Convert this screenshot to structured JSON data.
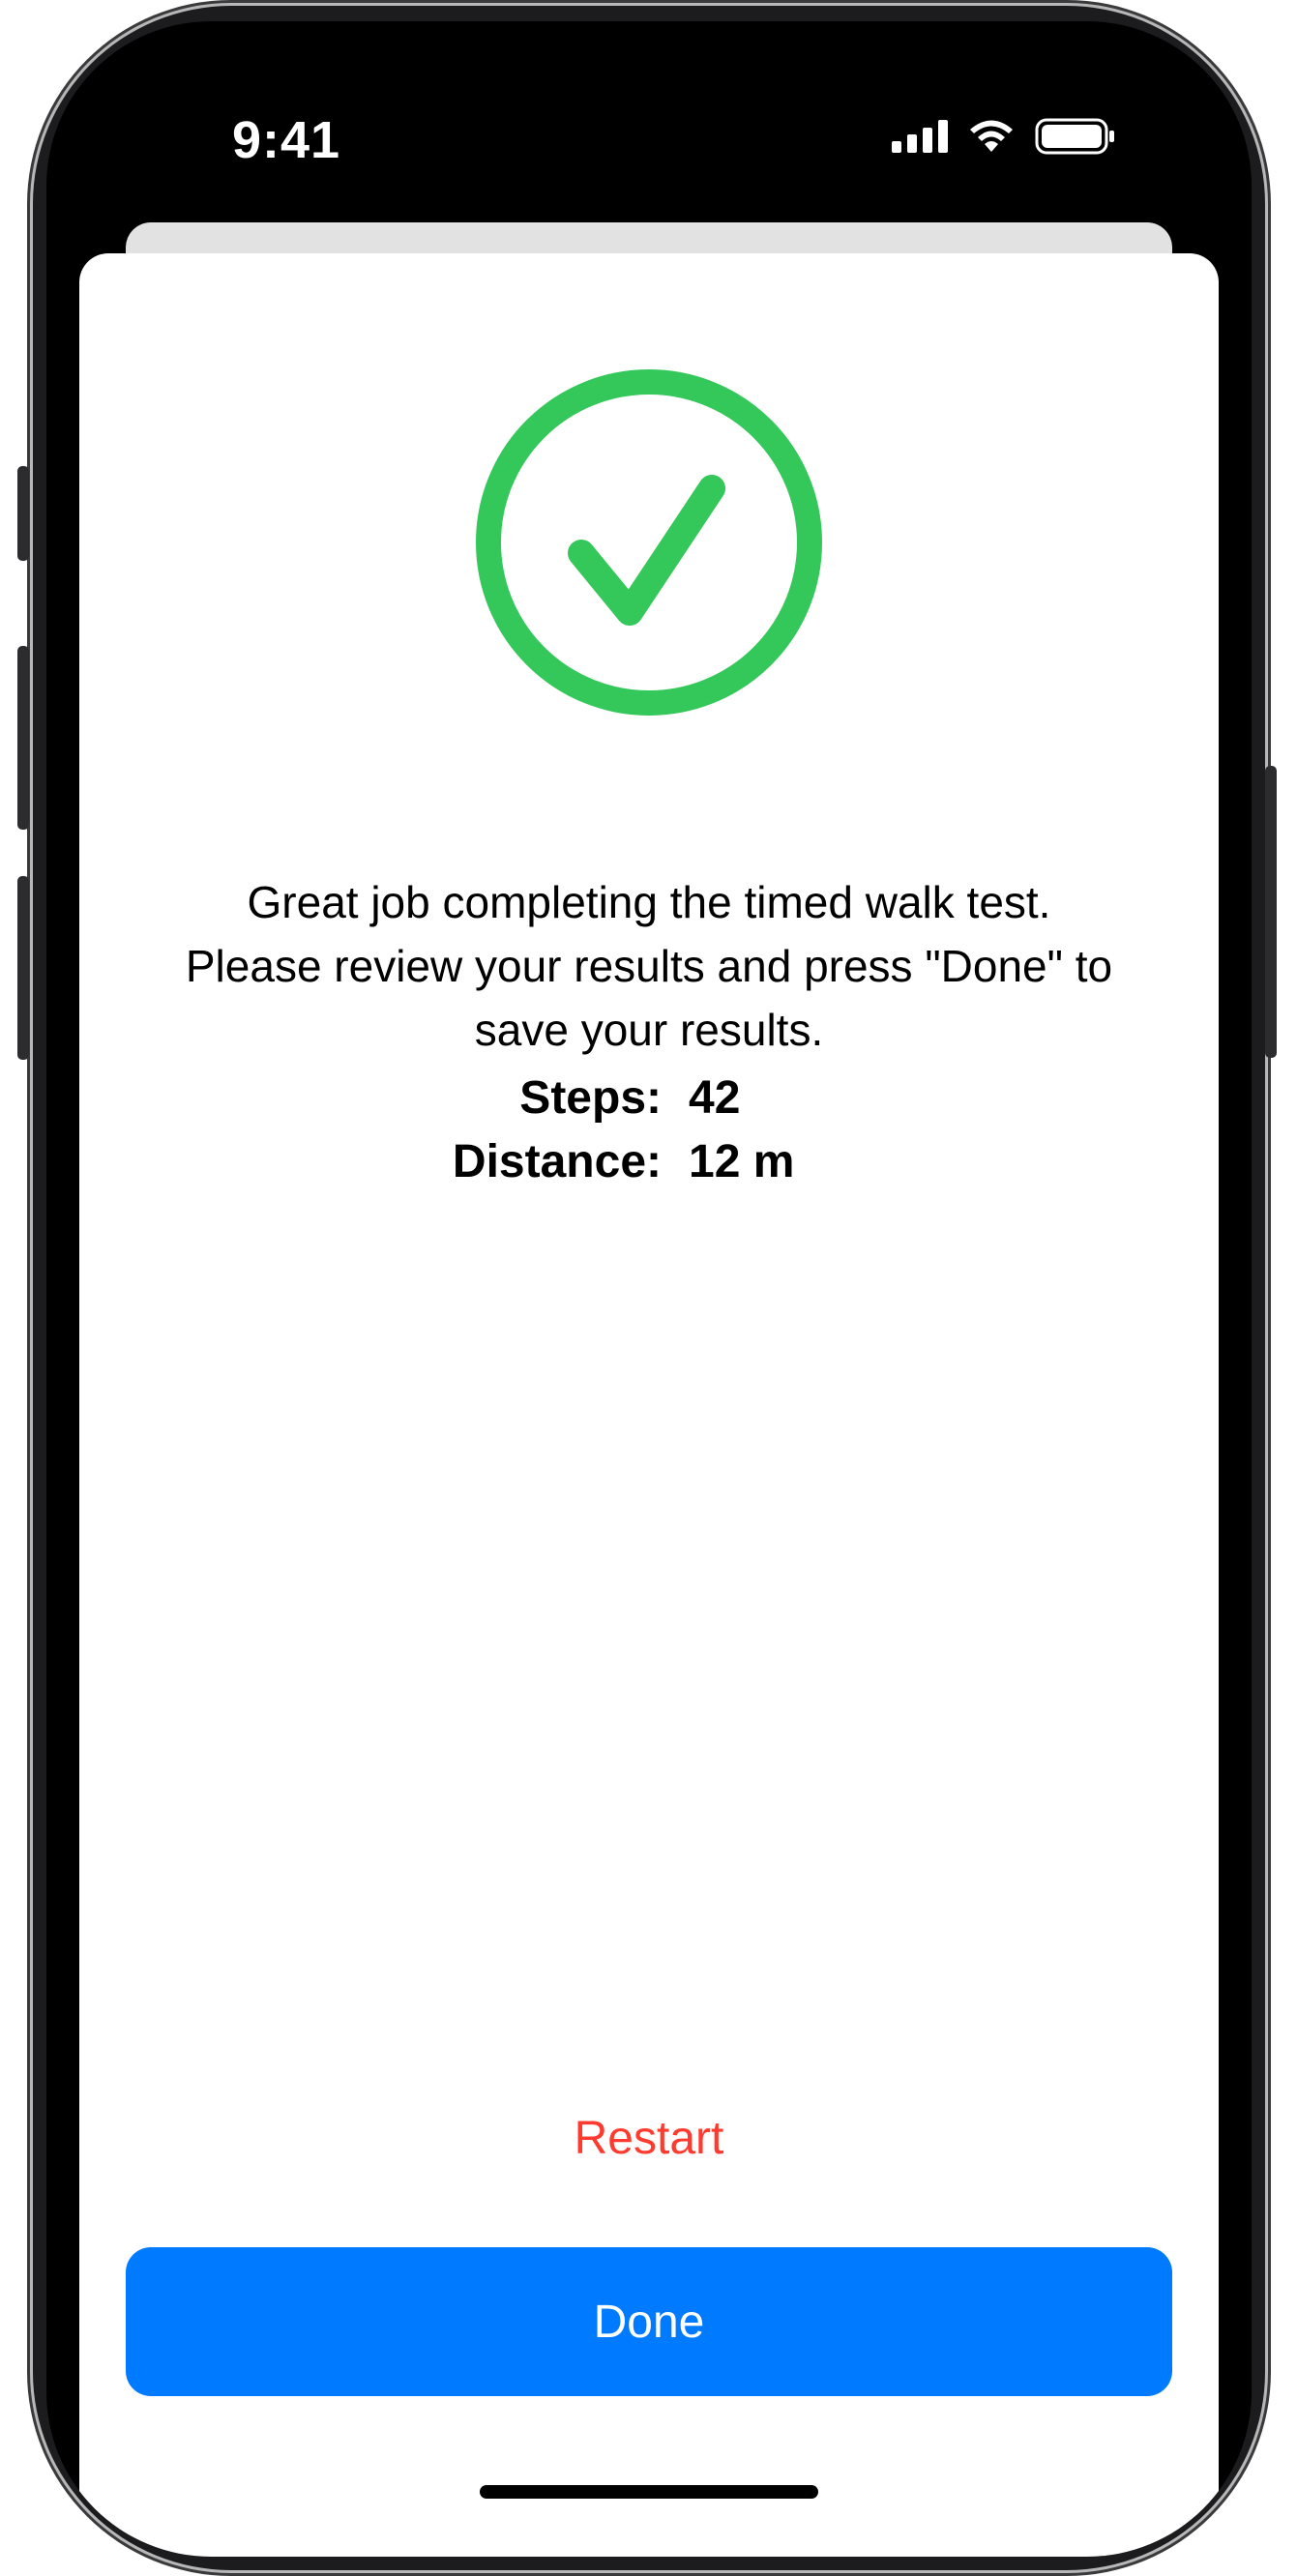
{
  "status_bar": {
    "time": "9:41"
  },
  "completion": {
    "icon": "checkmark-circle-icon",
    "accent_color": "#34c759",
    "message_lines": [
      "Great job completing the timed walk test.",
      "Please review your results and press \"Done\" to",
      "save your results."
    ]
  },
  "results": {
    "steps": {
      "label": "Steps:",
      "value": "42"
    },
    "distance": {
      "label": "Distance:",
      "value": "12 m"
    }
  },
  "actions": {
    "restart_label": "Restart",
    "restart_color": "#ff3b30",
    "done_label": "Done",
    "done_color": "#007aff"
  }
}
